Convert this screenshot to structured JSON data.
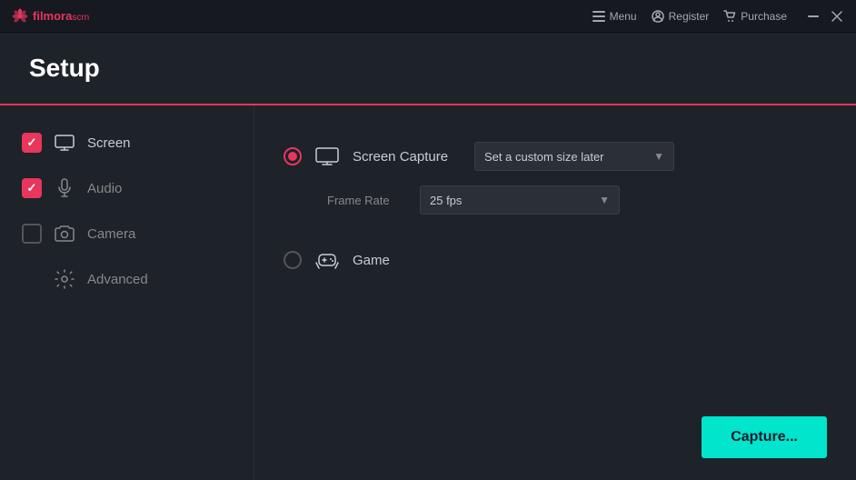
{
  "titlebar": {
    "logo_text": "filmora",
    "logo_scrn": "scrn",
    "menu_label": "Menu",
    "register_label": "Register",
    "purchase_label": "Purchase"
  },
  "header": {
    "title": "Setup"
  },
  "sidebar": {
    "items": [
      {
        "id": "screen",
        "label": "Screen",
        "checked": true,
        "active": true
      },
      {
        "id": "audio",
        "label": "Audio",
        "checked": true,
        "active": false
      },
      {
        "id": "camera",
        "label": "Camera",
        "checked": false,
        "active": false
      },
      {
        "id": "advanced",
        "label": "Advanced",
        "checked": null,
        "active": false
      }
    ]
  },
  "content": {
    "screen_capture_label": "Screen Capture",
    "screen_capture_size_label": "Set a custom size later",
    "frame_rate_label": "Frame Rate",
    "frame_rate_value": "25 fps",
    "game_label": "Game",
    "capture_btn_label": "Capture..."
  }
}
